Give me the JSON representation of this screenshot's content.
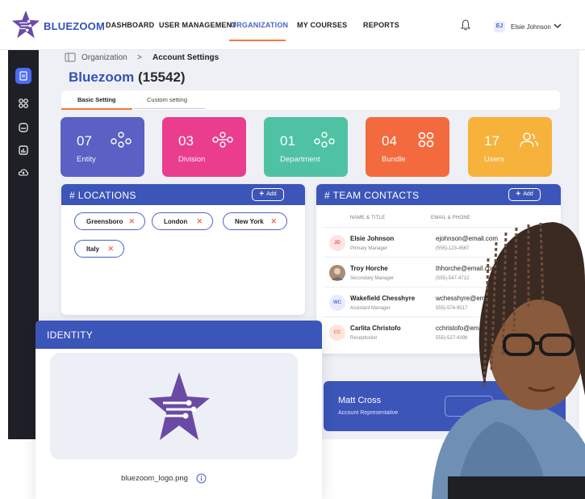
{
  "app": {
    "brand": "BLUEZOOM"
  },
  "nav": {
    "items": [
      "DASHBOARD",
      "USER MANAGEMENT",
      "ORGANIZATION",
      "MY COURSES",
      "REPORTS"
    ],
    "active": "ORGANIZATION"
  },
  "user": {
    "initials": "EJ",
    "name": "Elsie Johnson"
  },
  "sidebar": {
    "icons": [
      "document-icon",
      "grid-icon",
      "courses-icon",
      "reports-icon",
      "cloud-icon"
    ]
  },
  "breadcrumb": {
    "root": "Organization",
    "separator": ">",
    "current": "Account Settings"
  },
  "page": {
    "title": "Bluezoom",
    "count": "(15542)"
  },
  "tabs": [
    "Basic Setting",
    "Custom setting"
  ],
  "stats": [
    {
      "value": "07",
      "label": "Entity",
      "color": "#5a60c4"
    },
    {
      "value": "03",
      "label": "Division",
      "color": "#ea3d8e"
    },
    {
      "value": "01",
      "label": "Department",
      "color": "#4fc2a4"
    },
    {
      "value": "04",
      "label": "Bundle",
      "color": "#f36a3e"
    },
    {
      "value": "17",
      "label": "Users",
      "color": "#f7b23b"
    }
  ],
  "locations": {
    "title": "# LOCATIONS",
    "add_label": "Add",
    "chips": [
      "Greensboro",
      "London",
      "New York",
      "Italy"
    ]
  },
  "team": {
    "title": "# TEAM CONTACTS",
    "add_label": "Add",
    "col_name": "NAME & TITLE",
    "col_contact": "EMAIL & PHONE",
    "rows": [
      {
        "initials": "JD",
        "name": "Elsie Johnson",
        "role": "Primary Manager",
        "email": "ejohnson@email.com",
        "phone": "(555)-123-4567"
      },
      {
        "initials": "",
        "name": "Troy Horche",
        "role": "Secondary Manager",
        "email": "thhorche@email.com",
        "phone": "(555)-547-4712"
      },
      {
        "initials": "WC",
        "name": "Wakefield Chesshyre",
        "role": "Assistant Manager",
        "email": "wchesshyre@ema",
        "phone": "555)-574-9517"
      },
      {
        "initials": "CC",
        "name": "Carlita Christofo",
        "role": "Receptionist",
        "email": "cchristofo@ema",
        "phone": "555)-527-4398"
      }
    ]
  },
  "rep": {
    "name": "Matt Cross",
    "role": "Account Representative"
  },
  "identity": {
    "title": "IDENTITY",
    "file": "bluezoom_logo.png"
  },
  "colors": {
    "brand_blue": "#3c55b8",
    "accent_orange": "#f07a3a",
    "logo_purple": "#6b4aa6"
  }
}
